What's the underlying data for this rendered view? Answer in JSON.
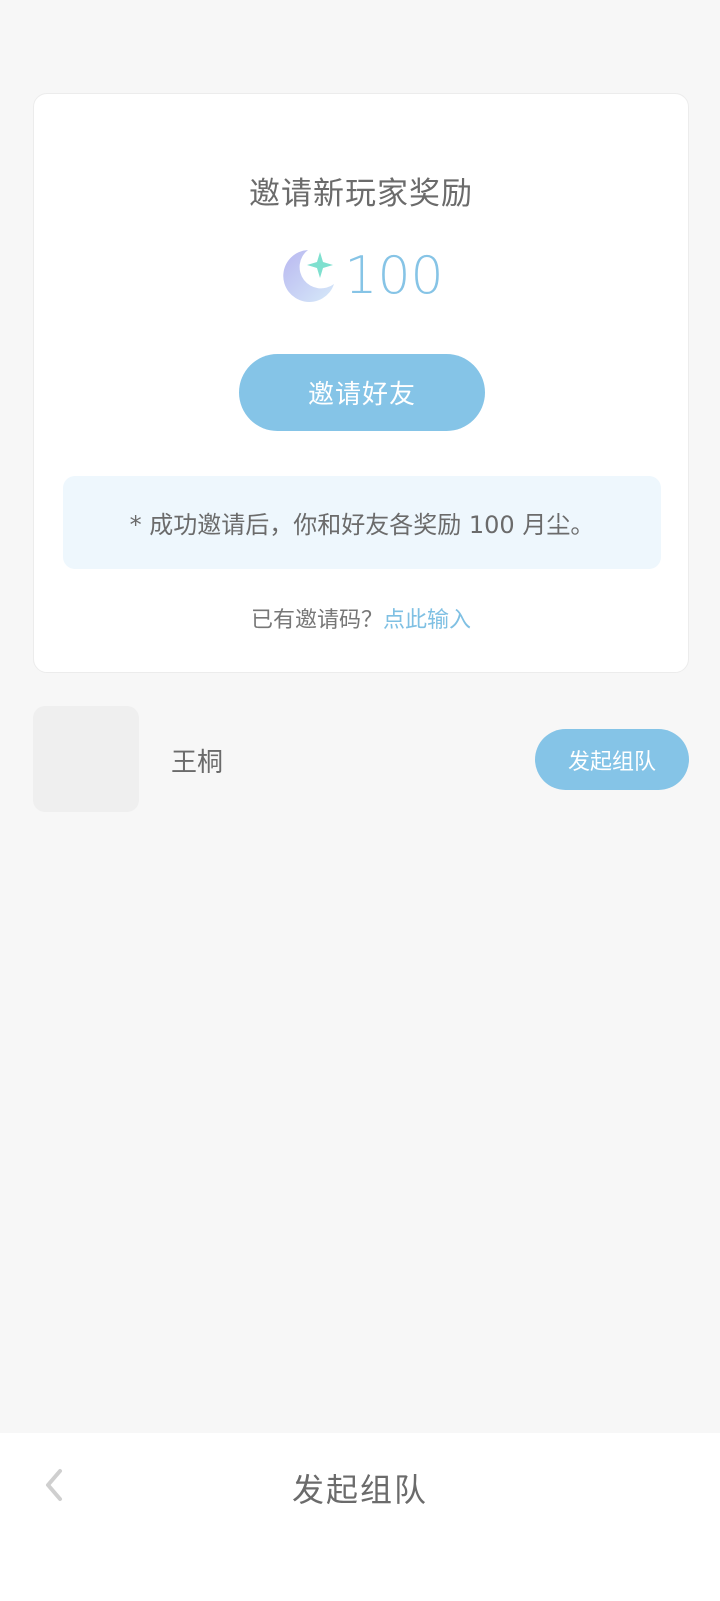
{
  "card": {
    "title": "邀请新玩家奖励",
    "reward_amount": "100",
    "reward_icon": "moon-dust-icon",
    "invite_button": "邀请好友",
    "notice": "* 成功邀请后，你和好友各奖励 100 月尘。",
    "code_prompt": "已有邀请码？",
    "code_link": "点此输入"
  },
  "friends": [
    {
      "name": "王桐",
      "action": "发起组队"
    }
  ],
  "bottom_bar": {
    "title": "发起组队",
    "back_icon": "chevron-left-icon"
  },
  "colors": {
    "accent": "#85c4e7",
    "notice_bg": "#eef7fd",
    "page_bg": "#f7f7f7"
  }
}
